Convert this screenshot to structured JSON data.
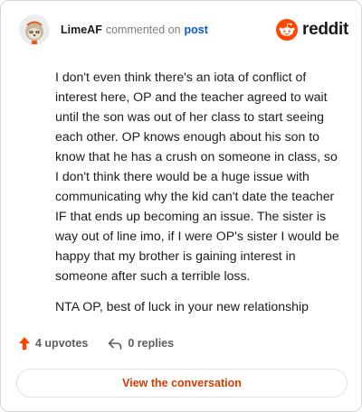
{
  "comment": {
    "author": "LimeAF",
    "action": "commented on",
    "target": "post",
    "paragraphs": [
      "I don't even think there's an iota of conflict of interest here, OP and the teacher agreed to wait until the son was out of her class to start seeing each other. OP knows enough about his son to know that he has a crush on someone in class, so I don't think there would be a huge issue with communicating why the kid can't date the teacher IF that ends up becoming an issue. The sister is way out of line imo, if I were OP's sister I would be happy that my brother is gaining interest in someone after such a terrible loss.",
      "NTA OP, best of luck in your new relationship"
    ],
    "upvotes": "4 upvotes",
    "replies": "0 replies"
  },
  "brand": {
    "name": "reddit",
    "color": "#ff4500"
  },
  "cta": {
    "label": "View the conversation"
  },
  "colors": {
    "accent": "#d93a00",
    "link": "#0a5ac2",
    "upvote": "#ff4500",
    "muted": "#5e5e5e"
  },
  "icons": {
    "avatar": "sloth-avatar",
    "logo": "reddit-snoo-icon",
    "upvote": "upvote-arrow-icon",
    "reply": "reply-arrow-icon"
  }
}
